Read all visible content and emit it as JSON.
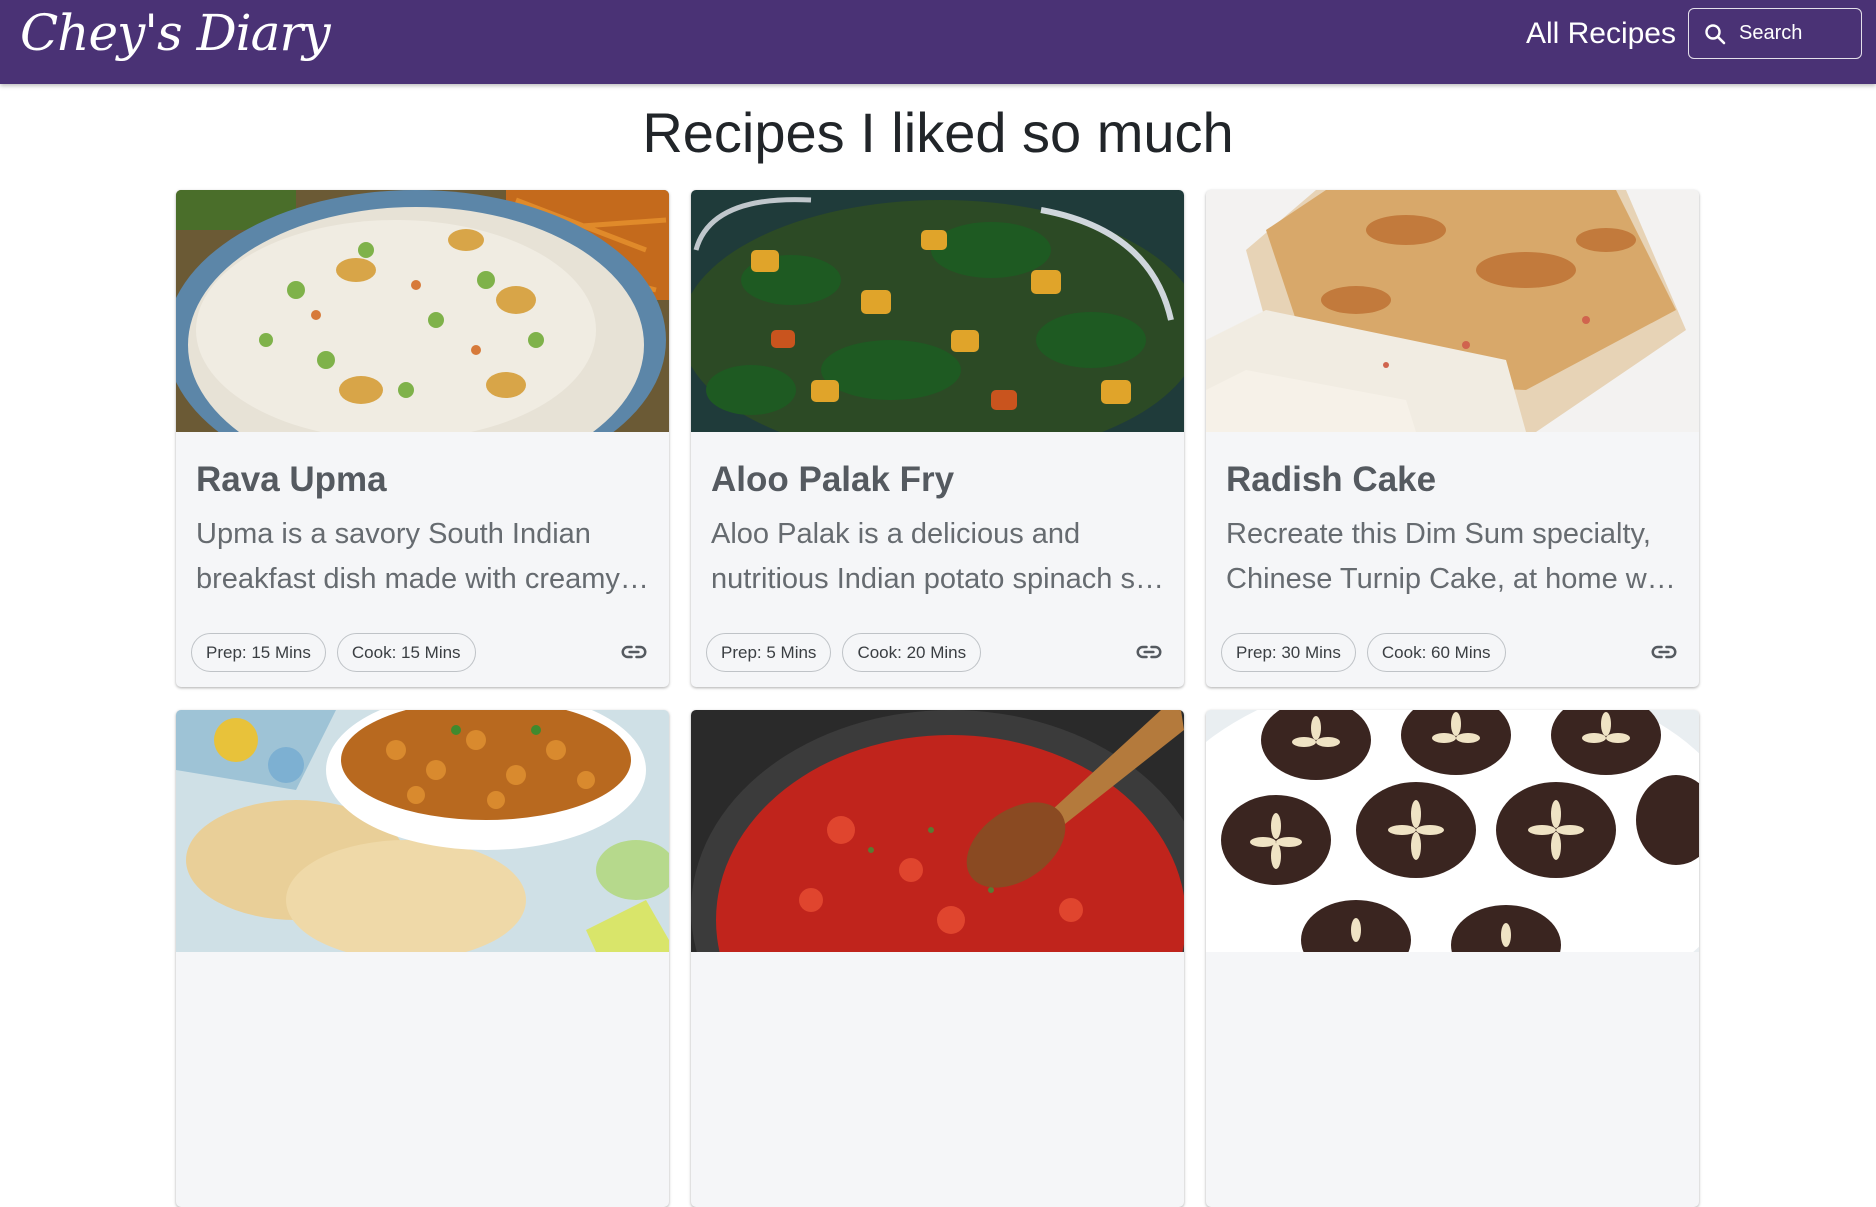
{
  "header": {
    "brand": "Chey's Diary",
    "nav_link": "All Recipes",
    "search_placeholder": "Search",
    "background_color": "#4a3275"
  },
  "page": {
    "title": "Recipes I liked so much"
  },
  "recipes": [
    {
      "title": "Rava Upma",
      "description": "Upma is a savory South Indian breakfast dish made with creamy roasted semolina, vegetables and cashews.",
      "prep": "Prep: 15 Mins",
      "cook": "Cook: 15 Mins",
      "image": "rava-upma-photo"
    },
    {
      "title": "Aloo Palak Fry",
      "description": "Aloo Palak is a delicious and nutritious Indian potato spinach stir fry made with simple spices.",
      "prep": "Prep: 5 Mins",
      "cook": "Cook: 20 Mins",
      "image": "aloo-palak-photo"
    },
    {
      "title": "Radish Cake",
      "description": "Recreate this Dim Sum specialty, Chinese Turnip Cake, at home with this easy pan-fried recipe.",
      "prep": "Prep: 30 Mins",
      "cook": "Cook: 60 Mins",
      "image": "radish-cake-photo"
    },
    {
      "title": "",
      "description": "",
      "prep": "",
      "cook": "",
      "image": "chole-bhature-photo"
    },
    {
      "title": "",
      "description": "",
      "prep": "",
      "cook": "",
      "image": "tomato-sauce-photo"
    },
    {
      "title": "",
      "description": "",
      "prep": "",
      "cook": "",
      "image": "chocolate-sweets-photo"
    }
  ],
  "icons": {
    "search": "search-icon",
    "link": "link-icon"
  }
}
